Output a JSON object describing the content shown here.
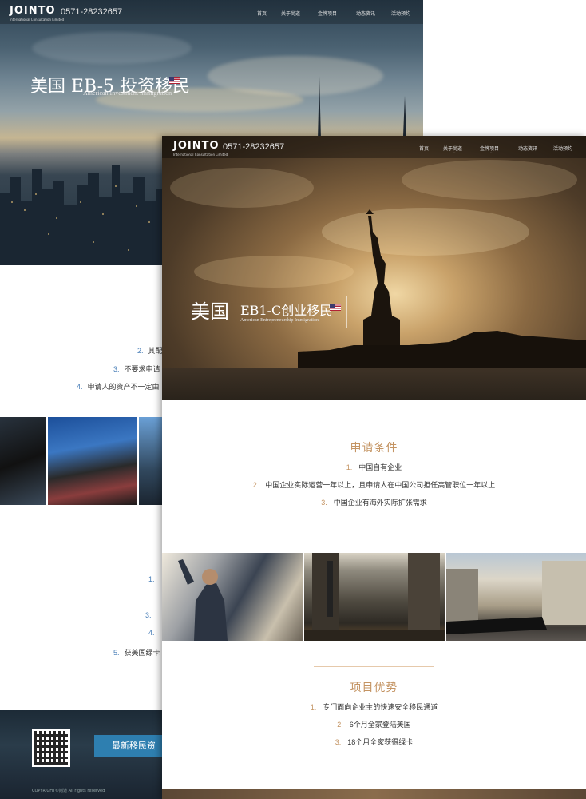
{
  "back_page": {
    "logo": "JOINTO",
    "logo_sub": "International Consultation Limited",
    "phone": "0571-28232657",
    "nav": [
      "首页",
      "关于尚道",
      "金牌项目",
      "动态资讯",
      "活动预约"
    ],
    "hero_title": "美国 EB-5 投资移民",
    "hero_subtitle": "American Investment Immigration",
    "list_top": [
      {
        "n": "2.",
        "text": "其配"
      },
      {
        "n": "3.",
        "text": "不要求申请"
      },
      {
        "n": "4.",
        "text": "申请人的资产不一定由"
      }
    ],
    "list_bottom": [
      {
        "n": "1."
      },
      {
        "n": "3."
      },
      {
        "n": "4."
      },
      {
        "n": "5.",
        "text": "获美国绿卡"
      }
    ],
    "news_button": "最新移民资",
    "copyright": "COPYRIGHT©尚道 All rights reserved"
  },
  "front_page": {
    "logo": "JOINTO",
    "logo_sub": "International Consultation Limited",
    "phone": "0571-28232657",
    "nav": [
      "首页",
      "关于尚道",
      "金牌项目",
      "动态资讯",
      "活动预约"
    ],
    "hero_title": "美国",
    "hero_program": "EB1-C创业移民",
    "hero_subtitle": "American Entrepreneurship Immigration",
    "conditions_title": "申请条件",
    "conditions": [
      {
        "n": "1.",
        "text": "中国自有企业"
      },
      {
        "n": "2.",
        "text": "中国企业实际运营一年以上，且申请人在中国公司担任高管职位一年以上"
      },
      {
        "n": "3.",
        "text": "中国企业有海外实际扩张需求"
      }
    ],
    "advantages_title": "项目优势",
    "advantages": [
      {
        "n": "1.",
        "text": "专门面向企业主的快速安全移民通道"
      },
      {
        "n": "2.",
        "text": "6个月全家登陆美国"
      },
      {
        "n": "3.",
        "text": "18个月全家获得绿卡"
      }
    ]
  },
  "colors": {
    "accent": "#c49463",
    "back_accent": "#2e7fb0"
  }
}
